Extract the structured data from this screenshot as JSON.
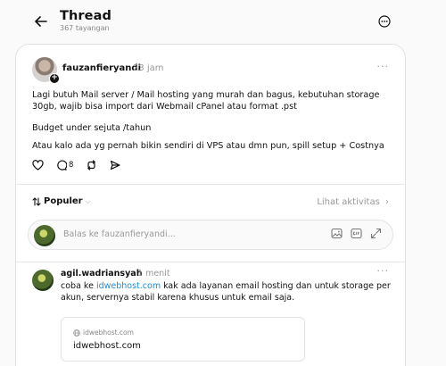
{
  "header": {
    "title": "Thread",
    "views": "367 tayangan"
  },
  "post": {
    "username": "fauzanfieryandi",
    "time": "23 jam",
    "text1": "Lagi butuh Mail server / Mail hosting yang murah dan bagus, kebutuhan storage 30gb, wajib bisa import dari Webmail cPanel atau format .pst",
    "text2": "Budget under sejuta /tahun",
    "text3": "Atau kalo ada yg pernah bikin sendiri di VPS atau dmn pun, spill setup + Costnya",
    "reply_count": "8"
  },
  "sort": {
    "label": "Populer",
    "activity_label": "Lihat aktivitas"
  },
  "reply_box": {
    "placeholder": "Balas ke fauzanfieryandi..."
  },
  "comment": {
    "username": "agil.wadriansyah",
    "time": "1 menit",
    "text_before": "coba ke ",
    "link_text": "idwebhost.com",
    "text_after": " kak ada layanan email hosting dan untuk storage per akun, servernya stabil karena khusus untuk email saja.",
    "preview_domain": "idwebhost.com",
    "preview_title": "idwebhost.com"
  },
  "icons": {
    "back": "arrow-left-icon",
    "more": "more-horizontal-circle-icon",
    "like": "heart-icon",
    "comment": "comment-icon",
    "repost": "repost-icon",
    "share": "send-icon",
    "image": "image-icon",
    "gif": "gif-icon",
    "expand": "expand-icon",
    "globe": "globe-icon"
  }
}
